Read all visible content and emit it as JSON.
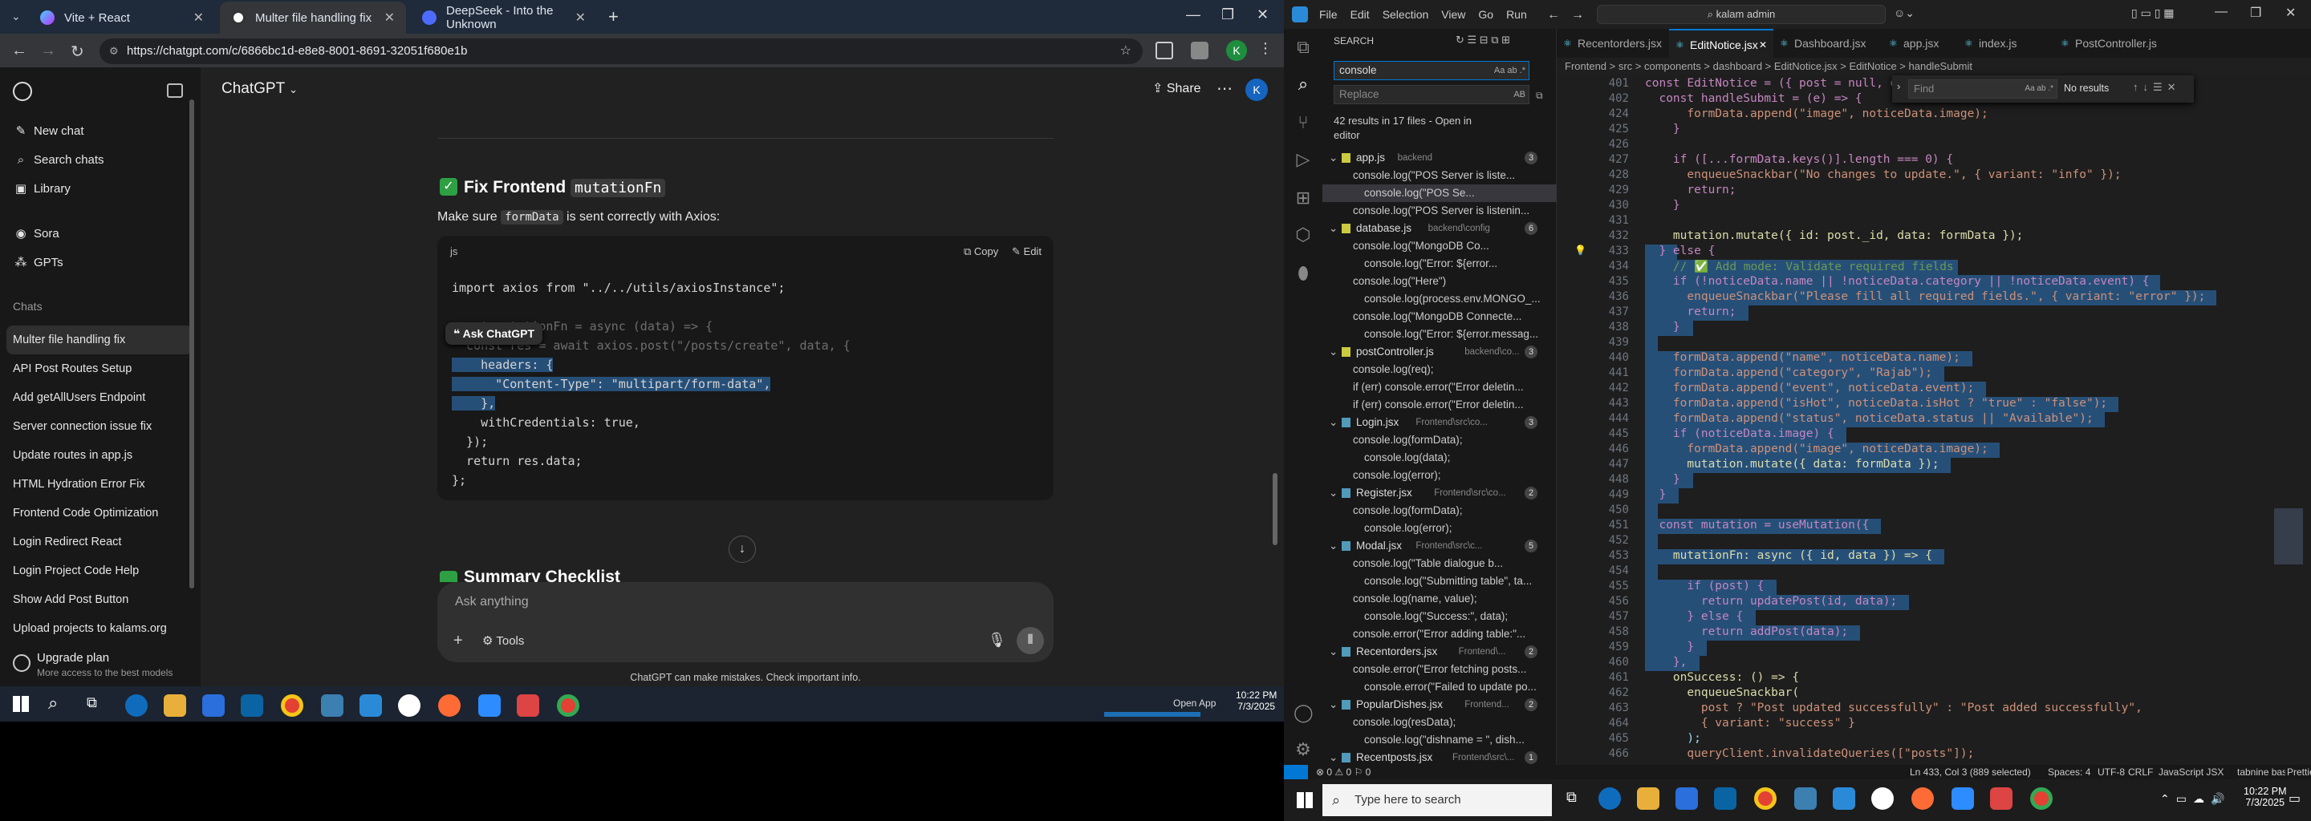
{
  "browser": {
    "tabs": [
      {
        "label": "Vite + React"
      },
      {
        "label": "Multer file handling fix"
      },
      {
        "label": "DeepSeek - Into the Unknown"
      }
    ],
    "url": "https://chatgpt.com/c/6866bc1d-e8e8-8001-8691-32051f680e1b"
  },
  "chatgpt": {
    "model": "ChatGPT",
    "share_label": "Share",
    "avatar_initial": "K",
    "nav": {
      "new_chat": "New chat",
      "search_chats": "Search chats",
      "library": "Library",
      "sora": "Sora",
      "gpts": "GPTs",
      "chats_heading": "Chats"
    },
    "chats": [
      "Multer file handling fix",
      "API Post Routes Setup",
      "Add getAllUsers Endpoint",
      "Server connection issue fix",
      "Update routes in app.js",
      "HTML Hydration Error Fix",
      "Frontend Code Optimization",
      "Login Redirect React",
      "Login Project Code Help",
      "Show Add Post Button",
      "Upload projects to kalams.org"
    ],
    "upgrade": {
      "title": "Upgrade plan",
      "subtitle": "More access to the best models"
    },
    "heading_prefix": "Fix Frontend",
    "heading_code": "mutationFn",
    "subtitle_a": "Make sure",
    "subtitle_code": "formData",
    "subtitle_b": "is sent correctly with Axios:",
    "code_lang": "js",
    "copy_label": "Copy",
    "edit_label": "Edit",
    "ask_label": "Ask ChatGPT",
    "code_lines": [
      "import axios from \"../../utils/axiosInstance\";",
      "",
      "const mutationFn = async (data) => {",
      "  const res = await axios.post(\"/posts/create\", data, {",
      "    headers: {",
      "      \"Content-Type\": \"multipart/form-data\",",
      "    },",
      "    withCredentials: true,",
      "  });",
      "  return res.data;",
      "};"
    ],
    "summary_heading": "Summary Checklist",
    "input_placeholder": "Ask anything",
    "tools_label": "Tools",
    "disclaimer": "ChatGPT can make mistakes. Check important info."
  },
  "taskbar_left": {
    "time": "10:22 PM",
    "date": "7/3/2025",
    "open_app": "Open App"
  },
  "vscode": {
    "menu": [
      "File",
      "Edit",
      "Selection",
      "View",
      "Go",
      "Run"
    ],
    "command_center": "kalam admin",
    "search": {
      "title": "SEARCH",
      "query": "console",
      "replace_placeholder": "Replace",
      "summary": "42 results in 17 files - Open in editor",
      "files": [
        {
          "name": "app.js",
          "path": "backend",
          "count": "3",
          "lines": [
            "console.log(\"POS Server is liste...",
            "console.log(\"POS Se...",
            "console.log(\"POS Server is listenin..."
          ]
        },
        {
          "name": "database.js",
          "path": "backend\\config",
          "count": "6",
          "lines": [
            "console.log(\"MongoDB Co...",
            "console.log(\"Error: ${error...",
            "console.log(\"Here\")",
            "console.log(process.env.MONGO_...",
            "console.log(\"MongoDB Connecte...",
            "console.log(\"Error: ${error.messag..."
          ]
        },
        {
          "name": "postController.js",
          "path": "backend\\co...",
          "count": "3",
          "lines": [
            "console.log(req);",
            "if (err) console.error(\"Error deletin...",
            "if (err) console.error(\"Error deletin..."
          ]
        },
        {
          "name": "Login.jsx",
          "path": "Frontend\\src\\co...",
          "count": "3",
          "lines": [
            "console.log(formData);",
            "console.log(data);",
            "console.log(error);"
          ]
        },
        {
          "name": "Register.jsx",
          "path": "Frontend\\src\\co...",
          "count": "2",
          "lines": [
            "console.log(formData);",
            "console.log(error);"
          ]
        },
        {
          "name": "Modal.jsx",
          "path": "Frontend\\src\\c...",
          "count": "5",
          "lines": [
            "console.log(\"Table dialogue b...",
            "console.log(\"Submitting table\", ta...",
            "console.log(name, value);",
            "console.log(\"Success:\", data);",
            "console.error(\"Error adding table:\"..."
          ]
        },
        {
          "name": "Recentorders.jsx",
          "path": "Frontend\\...",
          "count": "2",
          "lines": [
            "console.error(\"Error fetching posts...",
            "console.error(\"Failed to update po..."
          ]
        },
        {
          "name": "PopularDishes.jsx",
          "path": "Frontend...",
          "count": "2",
          "lines": [
            "console.log(resData);",
            "console.log(\"dishname = \", dish..."
          ]
        },
        {
          "name": "Recentposts.jsx",
          "path": "Frontend\\src\\...",
          "count": "1",
          "lines": []
        }
      ]
    },
    "tabs": [
      "Recentorders.jsx",
      "EditNotice.jsx",
      "Dashboard.jsx",
      "app.jsx",
      "index.js",
      "PostController.js"
    ],
    "breadcrumb": "Frontend > src > components > dashboard > EditNotice.jsx > EditNotice > handleSubmit",
    "find": {
      "placeholder": "Find",
      "result": "No results"
    },
    "first_line_no": "402",
    "editor_lines": [
      {
        "no": "401",
        "text": "const EditNotice = ({ post = null, onClose }) => {"
      },
      {
        "no": "402",
        "text": "  const handleSubmit = (e) => {"
      },
      {
        "no": "424",
        "text": "      formData.append(\"image\", noticeData.image);"
      },
      {
        "no": "425",
        "text": "    }"
      },
      {
        "no": "426",
        "text": ""
      },
      {
        "no": "427",
        "text": "    if ([...formData.keys()].length === 0) {"
      },
      {
        "no": "428",
        "text": "      enqueueSnackbar(\"No changes to update.\", { variant: \"info\" });"
      },
      {
        "no": "429",
        "text": "      return;"
      },
      {
        "no": "430",
        "text": "    }"
      },
      {
        "no": "431",
        "text": ""
      },
      {
        "no": "432",
        "text": "    mutation.mutate({ id: post._id, data: formData });"
      },
      {
        "no": "433",
        "text": "  } else {"
      },
      {
        "no": "434",
        "text": "    // ✅ Add mode: Validate required fields"
      },
      {
        "no": "435",
        "text": "    if (!noticeData.name || !noticeData.category || !noticeData.event) {"
      },
      {
        "no": "436",
        "text": "      enqueueSnackbar(\"Please fill all required fields.\", { variant: \"error\" });"
      },
      {
        "no": "437",
        "text": "      return;"
      },
      {
        "no": "438",
        "text": "    }"
      },
      {
        "no": "439",
        "text": ""
      },
      {
        "no": "440",
        "text": "    formData.append(\"name\", noticeData.name);"
      },
      {
        "no": "441",
        "text": "    formData.append(\"category\", \"Rajab\");"
      },
      {
        "no": "442",
        "text": "    formData.append(\"event\", noticeData.event);"
      },
      {
        "no": "443",
        "text": "    formData.append(\"isHot\", noticeData.isHot ? \"true\" : \"false\");"
      },
      {
        "no": "444",
        "text": "    formData.append(\"status\", noticeData.status || \"Available\");"
      },
      {
        "no": "445",
        "text": "    if (noticeData.image) {"
      },
      {
        "no": "446",
        "text": "      formData.append(\"image\", noticeData.image);"
      },
      {
        "no": "447",
        "text": "      mutation.mutate({ data: formData });"
      },
      {
        "no": "448",
        "text": "    }"
      },
      {
        "no": "449",
        "text": "  }"
      },
      {
        "no": "450",
        "text": ""
      },
      {
        "no": "451",
        "text": "  const mutation = useMutation({"
      },
      {
        "no": "452",
        "text": ""
      },
      {
        "no": "453",
        "text": "    mutationFn: async ({ id, data }) => {"
      },
      {
        "no": "454",
        "text": ""
      },
      {
        "no": "455",
        "text": "      if (post) {"
      },
      {
        "no": "456",
        "text": "        return updatePost(id, data);"
      },
      {
        "no": "457",
        "text": "      } else {"
      },
      {
        "no": "458",
        "text": "        return addPost(data);"
      },
      {
        "no": "459",
        "text": "      }"
      },
      {
        "no": "460",
        "text": "    },"
      },
      {
        "no": "461",
        "text": "    onSuccess: () => {"
      },
      {
        "no": "462",
        "text": "      enqueueSnackbar("
      },
      {
        "no": "463",
        "text": "        post ? \"Post updated successfully\" : \"Post added successfully\","
      },
      {
        "no": "464",
        "text": "        { variant: \"success\" }"
      },
      {
        "no": "465",
        "text": "      );"
      },
      {
        "no": "466",
        "text": "      queryClient.invalidateQueries([\"posts\"]);"
      }
    ],
    "status": {
      "left": "⊗ 0 ⚠ 0  ⚐ 0",
      "position": "Ln 433, Col 3 (889 selected)",
      "spaces": "Spaces: 4",
      "encoding": "UTF-8",
      "eol": "CRLF",
      "language": "JavaScript JSX",
      "tabnine": "tabnine basic",
      "prettier": "Prettier"
    }
  },
  "win_taskbar": {
    "search_placeholder": "Type here to search",
    "time": "10:22 PM",
    "date": "7/3/2025"
  },
  "colors": {
    "accent": "#0078d4",
    "chat_bg": "#212121",
    "editor_bg": "#1e1e1e",
    "selection": "#264f78",
    "check_green": "#2ea043"
  }
}
